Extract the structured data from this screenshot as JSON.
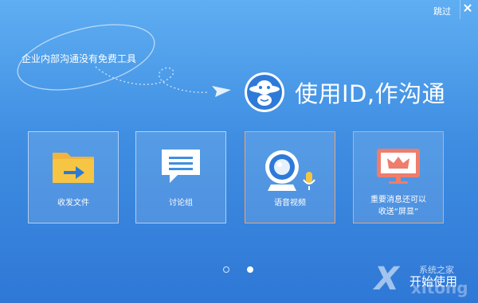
{
  "window": {
    "skip_label": "跳过",
    "close_icon": "close-icon"
  },
  "hero": {
    "tagline": "企业内部沟通没有免费工具",
    "headline": "使用ID,作沟通",
    "logo_icon": "alien-mascot-logo-icon"
  },
  "features": [
    {
      "label": "收发文件",
      "icon": "folder-arrow-icon"
    },
    {
      "label": "讨论组",
      "icon": "chat-bubble-icon"
    },
    {
      "label": "语音视频",
      "icon": "webcam-microphone-icon"
    },
    {
      "label_line1": "重要消息还可以",
      "label_line2": "收送“屏显”",
      "icon": "crown-monitor-icon"
    }
  ],
  "pagination": {
    "total": 2,
    "current": 2
  },
  "start_button": {
    "label": "开始使用"
  },
  "watermark": {
    "cn": "系统之家",
    "en": "xitong"
  },
  "colors": {
    "bg_top": "#5faef2",
    "bg_bottom": "#2f78d6",
    "folder": "#f7c544",
    "arrow": "#2a7bd6",
    "crown_monitor": "#ee7d6c",
    "mic": "#f5c542",
    "orange_border": "#f1a36a"
  }
}
